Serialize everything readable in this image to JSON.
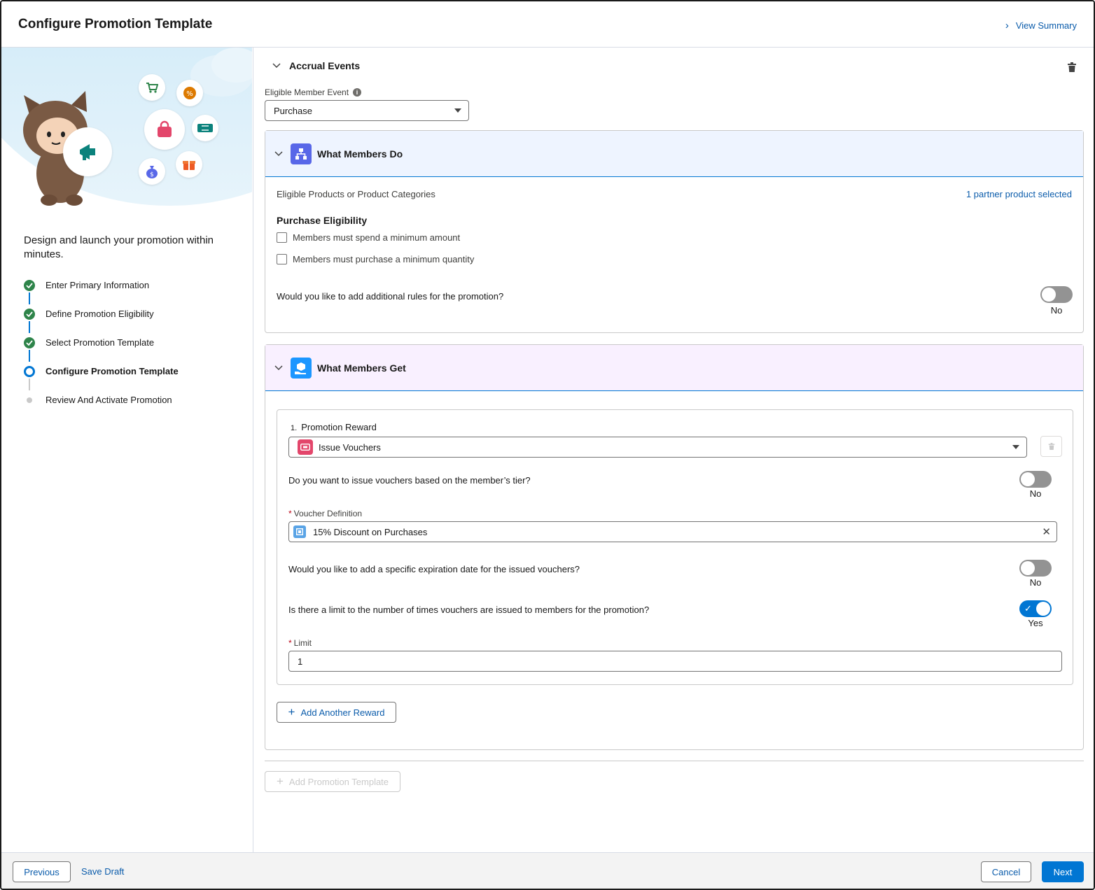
{
  "header": {
    "title": "Configure Promotion Template",
    "summary_link": "View Summary"
  },
  "sidebar": {
    "intro": "Design and launch your promotion within minutes.",
    "steps": [
      {
        "label": "Enter Primary Information",
        "status": "complete"
      },
      {
        "label": "Define Promotion Eligibility",
        "status": "complete"
      },
      {
        "label": "Select Promotion Template",
        "status": "complete"
      },
      {
        "label": "Configure Promotion Template",
        "status": "current"
      },
      {
        "label": "Review And Activate Promotion",
        "status": "upcoming"
      }
    ]
  },
  "accrual": {
    "section_title": "Accrual Events",
    "event_label": "Eligible Member Event",
    "event_value": "Purchase"
  },
  "members_do": {
    "title": "What Members Do",
    "products_label": "Eligible Products or Product Categories",
    "products_link": "1 partner product selected",
    "eligibility_heading": "Purchase Eligibility",
    "checkboxes": [
      {
        "label": "Members must spend a minimum amount",
        "checked": false
      },
      {
        "label": "Members must purchase a minimum quantity",
        "checked": false
      }
    ],
    "rules_question": "Would you like to add additional rules for the promotion?",
    "rules_toggle": "No"
  },
  "members_get": {
    "title": "What Members Get",
    "reward_number": "1.",
    "reward_label": "Promotion Reward",
    "reward_value": "Issue Vouchers",
    "tier_question": "Do you want to issue vouchers based on the member’s tier?",
    "tier_toggle": "No",
    "voucher_label": "Voucher Definition",
    "voucher_value": "15% Discount on Purchases",
    "expiry_question": "Would you like to add a specific expiration date for the issued vouchers?",
    "expiry_toggle": "No",
    "limit_question": "Is there a limit to the number of times vouchers are issued to members for the promotion?",
    "limit_toggle": "Yes",
    "limit_label": "Limit",
    "limit_value": "1",
    "add_reward": "Add Another Reward"
  },
  "add_template": "Add Promotion Template",
  "footer": {
    "previous": "Previous",
    "save_draft": "Save Draft",
    "cancel": "Cancel",
    "next": "Next"
  },
  "colors": {
    "brand": "#0176d3",
    "success": "#2e844a",
    "do_header": "#eef4ff",
    "get_header": "#f9f0ff",
    "do_icon": "#5867e8",
    "get_icon": "#1b96ff",
    "voucher_icon": "#e3466b"
  }
}
